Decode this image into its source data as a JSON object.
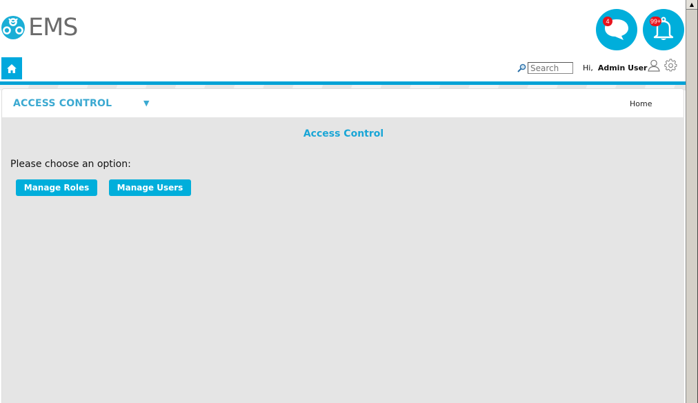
{
  "app": {
    "logo_text": "EMS"
  },
  "header": {
    "chat_badge": "4",
    "notification_badge": "99+",
    "search": {
      "placeholder": "Search",
      "value": ""
    },
    "greeting_prefix": "Hi,",
    "user_name": "Admin User"
  },
  "panel": {
    "section_title": "ACCESS CONTROL",
    "breadcrumb": "Home"
  },
  "content": {
    "title": "Access Control",
    "prompt": "Please choose an option:",
    "buttons": [
      {
        "label": "Manage Roles"
      },
      {
        "label": "Manage Users"
      }
    ]
  },
  "colors": {
    "accent": "#00aedb",
    "badge": "#e8141e",
    "body_bg": "#e5e5e5"
  }
}
